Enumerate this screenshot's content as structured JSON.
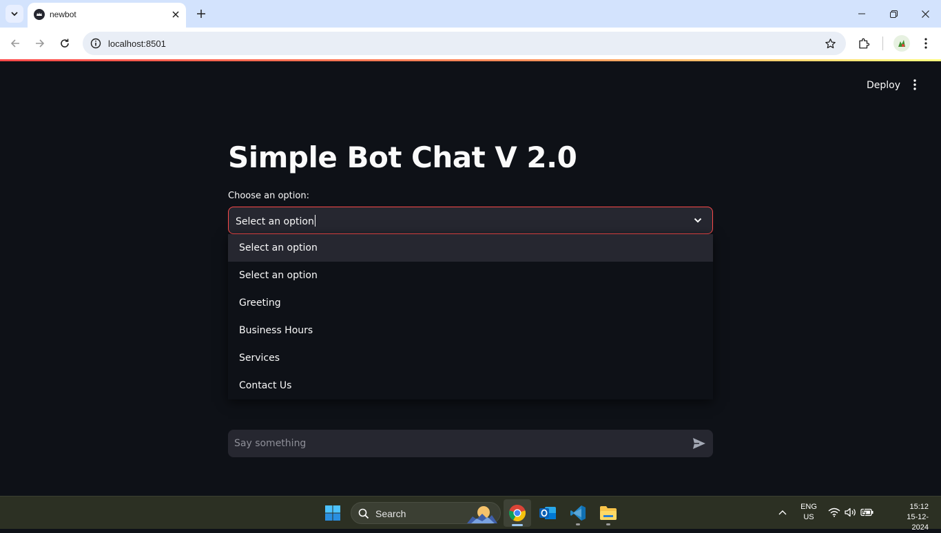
{
  "browser": {
    "tab_title": "newbot",
    "url": "localhost:8501",
    "icons": {
      "tab_search": "chevron-down-icon",
      "favicon": "streamlit-crown-icon",
      "tab_close": "close-icon",
      "new_tab": "plus-icon",
      "minimize": "minimize-icon",
      "restore": "restore-icon",
      "close_window": "close-icon",
      "back": "arrow-left-icon",
      "forward": "arrow-right-icon",
      "reload": "reload-icon",
      "site_info": "info-icon",
      "bookmark": "star-icon",
      "extensions": "puzzle-icon",
      "profile": "avatar-icon",
      "menu": "kebab-menu-icon"
    }
  },
  "app": {
    "deploy_label": "Deploy",
    "title": "Simple Bot Chat V 2.0",
    "select": {
      "label": "Choose an option:",
      "value": "Select an option",
      "options": [
        "Select an option",
        "Select an option",
        "Greeting",
        "Business Hours",
        "Services",
        "Contact Us"
      ],
      "highlighted_index": 0
    },
    "chat_input": {
      "placeholder": "Say something"
    },
    "colors": {
      "background": "#0e1117",
      "widget": "#262730",
      "accent": "#ff4b4b",
      "text": "#fafafa"
    }
  },
  "taskbar": {
    "search_label": "Search",
    "language": {
      "line1": "ENG",
      "line2": "US"
    },
    "clock": {
      "time": "15:12",
      "date": "15-12-2024"
    },
    "apps": [
      "windows-start-icon",
      "chrome-icon",
      "outlook-icon",
      "vscode-icon",
      "file-explorer-icon"
    ]
  }
}
